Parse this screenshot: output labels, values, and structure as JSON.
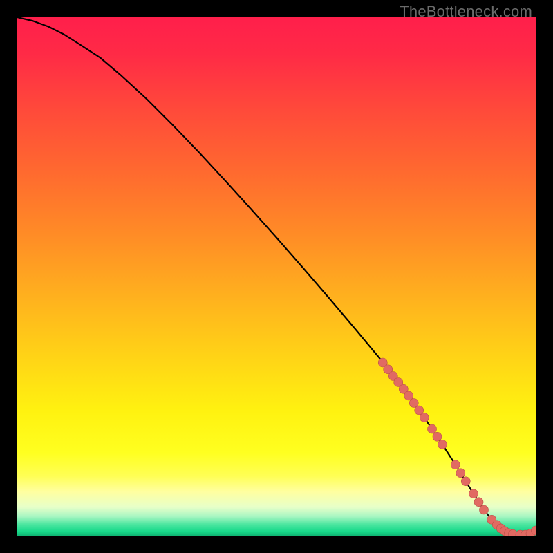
{
  "watermark": "TheBottleneck.com",
  "colors": {
    "background": "#000000",
    "curve": "#000000",
    "marker_fill": "#e16a62",
    "marker_stroke": "#b84d46",
    "gradient_stops": [
      {
        "offset": 0.0,
        "color": "#ff1f4b"
      },
      {
        "offset": 0.07,
        "color": "#ff2a46"
      },
      {
        "offset": 0.18,
        "color": "#ff4a3a"
      },
      {
        "offset": 0.3,
        "color": "#ff6a2f"
      },
      {
        "offset": 0.42,
        "color": "#ff8c26"
      },
      {
        "offset": 0.54,
        "color": "#ffb11e"
      },
      {
        "offset": 0.66,
        "color": "#ffd516"
      },
      {
        "offset": 0.76,
        "color": "#fff210"
      },
      {
        "offset": 0.84,
        "color": "#ffff20"
      },
      {
        "offset": 0.885,
        "color": "#ffff55"
      },
      {
        "offset": 0.915,
        "color": "#ffffa0"
      },
      {
        "offset": 0.945,
        "color": "#e7ffc9"
      },
      {
        "offset": 0.963,
        "color": "#a7f6c2"
      },
      {
        "offset": 0.978,
        "color": "#4de6a0"
      },
      {
        "offset": 0.992,
        "color": "#17d98a"
      },
      {
        "offset": 1.0,
        "color": "#0fb573"
      }
    ]
  },
  "chart_data": {
    "type": "line",
    "title": "",
    "xlabel": "",
    "ylabel": "",
    "xlim": [
      0,
      100
    ],
    "ylim": [
      0,
      100
    ],
    "series": [
      {
        "name": "bottleneck-curve",
        "x": [
          0,
          3,
          6,
          9,
          12,
          16,
          20,
          25,
          30,
          35,
          40,
          45,
          50,
          55,
          60,
          65,
          70,
          74,
          77,
          80,
          82,
          84,
          86,
          88,
          90,
          92,
          94,
          96,
          98,
          100
        ],
        "y": [
          100,
          99.3,
          98.2,
          96.7,
          94.8,
          92.2,
          88.8,
          84.2,
          79.2,
          74.0,
          68.6,
          63.1,
          57.5,
          51.8,
          46.0,
          40.1,
          34.1,
          29.0,
          24.9,
          20.6,
          17.6,
          14.5,
          11.3,
          8.1,
          5.0,
          2.5,
          0.9,
          0.2,
          0.2,
          1.0
        ]
      }
    ],
    "markers": {
      "name": "highlighted-range",
      "x": [
        70.5,
        71.5,
        72.5,
        73.5,
        74.5,
        75.5,
        76.5,
        77.5,
        78.5,
        80.0,
        81.0,
        82.0,
        84.5,
        85.5,
        86.5,
        88.0,
        89.0,
        90.0,
        91.5,
        92.5,
        93.3,
        94.0,
        94.8,
        95.6,
        97.0,
        98.0,
        99.0,
        100.0
      ],
      "y": [
        33.4,
        32.1,
        30.8,
        29.6,
        28.3,
        27.0,
        25.6,
        24.2,
        22.8,
        20.6,
        19.1,
        17.6,
        13.7,
        12.1,
        10.5,
        8.1,
        6.5,
        5.0,
        3.1,
        2.1,
        1.4,
        0.9,
        0.5,
        0.3,
        0.2,
        0.2,
        0.4,
        1.0
      ]
    }
  }
}
